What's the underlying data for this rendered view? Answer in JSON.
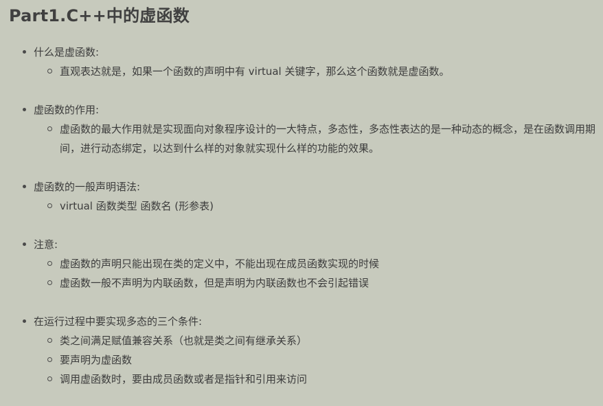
{
  "title": "Part1.C++中的虚函数",
  "sections": [
    {
      "title": "什么是虚函数:",
      "items": [
        "直观表达就是，如果一个函数的声明中有 virtual 关键字，那么这个函数就是虚函数。"
      ]
    },
    {
      "title": "虚函数的作用:",
      "items": [
        "虚函数的最大作用就是实现面向对象程序设计的一大特点，多态性，多态性表达的是一种动态的概念，是在函数调用期间，进行动态绑定，以达到什么样的对象就实现什么样的功能的效果。"
      ]
    },
    {
      "title": "虚函数的一般声明语法:",
      "items": [
        "virtual 函数类型 函数名 (形参表)"
      ]
    },
    {
      "title": "注意:",
      "items": [
        "虚函数的声明只能出现在类的定义中，不能出现在成员函数实现的时候",
        "虚函数一般不声明为内联函数，但是声明为内联函数也不会引起错误"
      ]
    },
    {
      "title": "在运行过程中要实现多态的三个条件:",
      "items": [
        "类之间满足赋值兼容关系（也就是类之间有继承关系）",
        "要声明为虚函数",
        "调用虚函数时，要由成员函数或者是指针和引用来访问"
      ]
    }
  ]
}
